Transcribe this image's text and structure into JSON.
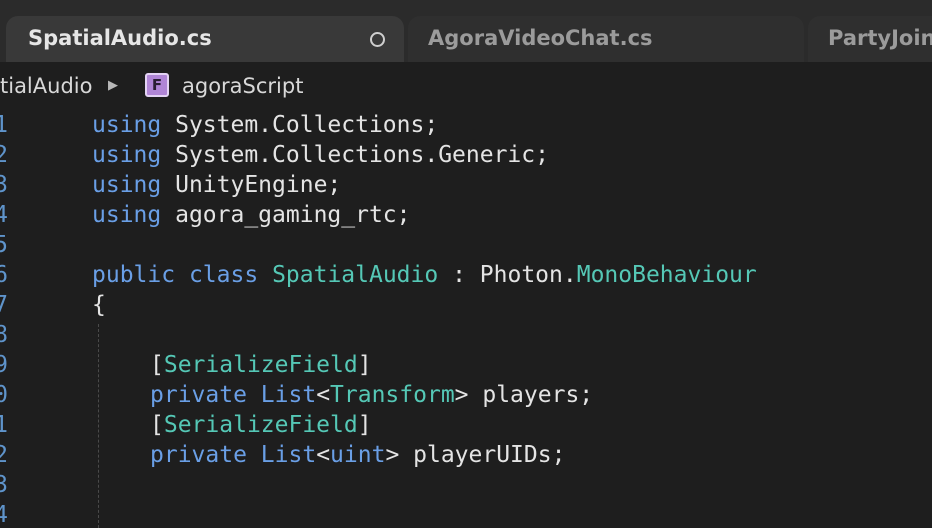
{
  "tabs": [
    {
      "label": "SpatialAudio.cs",
      "active": true,
      "unsaved": true
    },
    {
      "label": "AgoraVideoChat.cs",
      "active": false
    },
    {
      "label": "PartyJoin",
      "active": false
    }
  ],
  "breadcrumb": {
    "items": [
      "tialAudio",
      "agoraScript"
    ],
    "separator": "▶",
    "field_icon_letter": "F"
  },
  "editor": {
    "line_numbers": [
      "1",
      "2",
      "3",
      "4",
      "5",
      "6",
      "7",
      "8",
      "9",
      "0",
      "1",
      "2",
      "3",
      "4"
    ],
    "lines": [
      [
        "using",
        " System.Collections;"
      ],
      [
        "using",
        " System.Collections.Generic;"
      ],
      [
        "using",
        " UnityEngine;"
      ],
      [
        "using",
        " agora_gaming_rtc;"
      ],
      [],
      [
        "public",
        " ",
        "class",
        " ",
        "SpatialAudio",
        " : Photon.",
        "MonoBehaviour"
      ],
      [
        "{"
      ],
      [],
      [
        "[",
        "SerializeField",
        "]"
      ],
      [
        "private",
        " ",
        "List",
        "<",
        "Transform",
        "> players;"
      ],
      [
        "[",
        "SerializeField",
        "]"
      ],
      [
        "private",
        " ",
        "List",
        "<",
        "uint",
        "> playerUIDs;"
      ],
      [],
      []
    ]
  },
  "colors": {
    "keyword": "#6a9fe6",
    "type": "#55c8b6",
    "plain": "#e4e4e4",
    "line_number": "#5f94cb",
    "background": "#1e1e1e"
  },
  "icons": [
    "unsaved-dot-icon",
    "chevron-right-icon",
    "field-icon"
  ]
}
